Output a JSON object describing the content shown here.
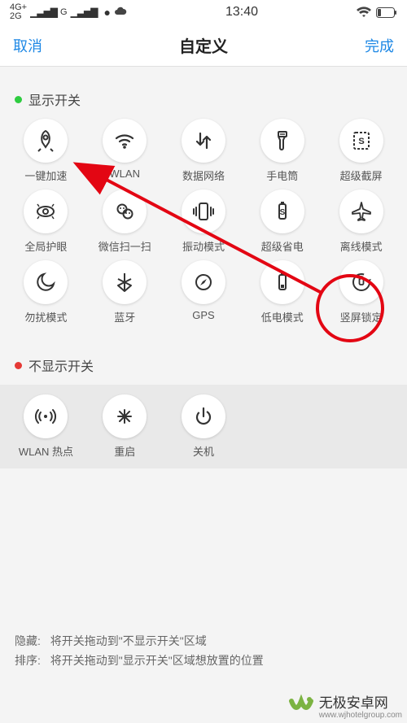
{
  "status": {
    "net1": "4G+",
    "net2": "2G",
    "time": "13:40"
  },
  "nav": {
    "cancel": "取消",
    "title": "自定义",
    "done": "完成"
  },
  "sections": {
    "show": "显示开关",
    "hide": "不显示开关"
  },
  "show_items": [
    {
      "name": "speedup",
      "label": "一键加速"
    },
    {
      "name": "wlan",
      "label": "WLAN"
    },
    {
      "name": "data",
      "label": "数据网络"
    },
    {
      "name": "flashlight",
      "label": "手电筒"
    },
    {
      "name": "screenshot",
      "label": "超级截屏"
    },
    {
      "name": "eyecare",
      "label": "全局护眼"
    },
    {
      "name": "wx-scan",
      "label": "微信扫一扫"
    },
    {
      "name": "vibrate",
      "label": "振动模式"
    },
    {
      "name": "supersave",
      "label": "超级省电"
    },
    {
      "name": "airplane",
      "label": "离线模式"
    },
    {
      "name": "dnd",
      "label": "勿扰模式"
    },
    {
      "name": "bluetooth",
      "label": "蓝牙"
    },
    {
      "name": "gps",
      "label": "GPS"
    },
    {
      "name": "lowpower",
      "label": "低电模式"
    },
    {
      "name": "rotation",
      "label": "竖屏锁定"
    }
  ],
  "hide_items": [
    {
      "name": "hotspot",
      "label": "WLAN 热点"
    },
    {
      "name": "reboot",
      "label": "重启"
    },
    {
      "name": "poweroff",
      "label": "关机"
    }
  ],
  "hints": {
    "hide_label": "隐藏:",
    "hide_text": "将开关拖动到\"不显示开关\"区域",
    "sort_label": "排序:",
    "sort_text": "将开关拖动到\"显示开关\"区域想放置的位置"
  },
  "watermark": {
    "brand": "无极安卓网",
    "url": "www.wjhotelgroup.com"
  },
  "colors": {
    "accent": "#1e88e5",
    "anno": "#e30613"
  }
}
